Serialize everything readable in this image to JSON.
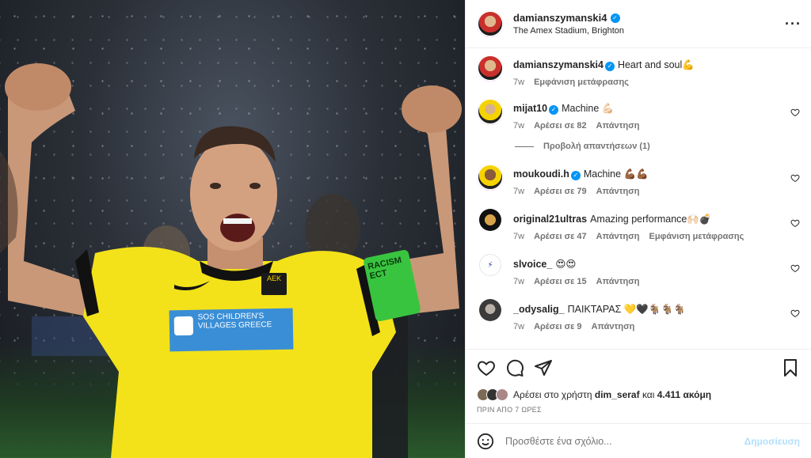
{
  "post": {
    "username": "damianszymanski4",
    "location": "The Amex Stadium, Brighton",
    "caption_user": "damianszymanski4",
    "caption_text": "Heart and soul💪",
    "caption_time": "7w",
    "caption_translate": "Εμφάνιση μετάφρασης"
  },
  "photo": {
    "jersey_sponsor": "SOS CHILDREN'S VILLAGES GREECE",
    "club_badge": "AEK",
    "armband_text": "RACISM ECT"
  },
  "comments": [
    {
      "user": "mijat10",
      "verified": true,
      "text": "Machine 💪🏻",
      "time": "7w",
      "likes": "Αρέσει σε 82",
      "reply": "Απάντηση"
    },
    {
      "user": "moukoudi.h",
      "verified": true,
      "text": "Machine 💪🏾💪🏾",
      "time": "7w",
      "likes": "Αρέσει σε 79",
      "reply": "Απάντηση"
    },
    {
      "user": "original21ultras",
      "verified": false,
      "text": "Amazing performance🙌🏻💣",
      "time": "7w",
      "likes": "Αρέσει σε 47",
      "reply": "Απάντηση",
      "translate": "Εμφάνιση μετάφρασης"
    },
    {
      "user": "slvoice_",
      "verified": false,
      "text": "😍😍",
      "time": "7w",
      "likes": "Αρέσει σε 15",
      "reply": "Απάντηση"
    },
    {
      "user": "_odysalig_",
      "verified": false,
      "text": "ΠΑΙΚΤΑΡΑΣ 💛🖤🐐🐐🐐",
      "time": "7w",
      "likes": "Αρέσει σε 9",
      "reply": "Απάντηση"
    }
  ],
  "view_replies": "Προβολή απαντήσεων (1)",
  "likes": {
    "prefix": "Αρέσει στο χρήστη",
    "user": "dim_seraf",
    "middle": "και",
    "count": "4.411 ακόμη"
  },
  "posted_ago": "ΠΡΙΝ ΑΠΟ 7 ΩΡΕΣ",
  "add_comment": {
    "placeholder": "Προσθέστε ένα σχόλιο...",
    "post_label": "Δημοσίευση"
  },
  "icons": {
    "more": "more-options-icon",
    "like": "heart-icon",
    "comment": "comment-icon",
    "share": "share-icon",
    "save": "bookmark-icon",
    "emoji": "emoji-icon",
    "verified": "verified-badge-icon"
  },
  "colors": {
    "accent": "#0095f6",
    "muted": "#737373",
    "post_disabled": "#b2dffc"
  }
}
